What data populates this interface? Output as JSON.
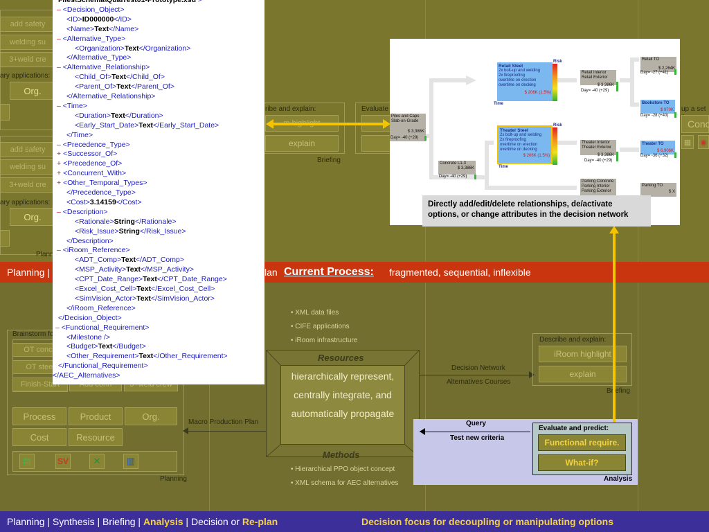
{
  "xml_lines": [
    {
      "d": 0,
      "t": [
        [
          "tx",
          "Files\\Schema\\Quarrest01-Prototype.xsd"
        ],
        [
          "tg",
          " >"
        ]
      ]
    },
    {
      "d": 0,
      "m": "–",
      "t": [
        [
          "tg",
          "<Decision_Object>"
        ]
      ]
    },
    {
      "d": 1,
      "t": [
        [
          "tg",
          "<ID>"
        ],
        [
          "tx",
          "ID000000"
        ],
        [
          "tg",
          "</ID>"
        ]
      ]
    },
    {
      "d": 1,
      "t": [
        [
          "tg",
          "<Name>"
        ],
        [
          "tx",
          "Text"
        ],
        [
          "tg",
          "</Name>"
        ]
      ]
    },
    {
      "d": 0,
      "m": "–",
      "t": [
        [
          "tg",
          "<Alternative_Type>"
        ]
      ]
    },
    {
      "d": 2,
      "t": [
        [
          "tg",
          "<Organization>"
        ],
        [
          "tx",
          "Text"
        ],
        [
          "tg",
          "</Organization>"
        ]
      ]
    },
    {
      "d": 1,
      "t": [
        [
          "tg",
          "</Alternative_Type>"
        ]
      ]
    },
    {
      "d": 0,
      "m": "–",
      "t": [
        [
          "tg",
          "<Alternative_Relationship>"
        ]
      ]
    },
    {
      "d": 2,
      "t": [
        [
          "tg",
          "<Child_Of>"
        ],
        [
          "tx",
          "Text"
        ],
        [
          "tg",
          "</Child_Of>"
        ]
      ]
    },
    {
      "d": 2,
      "t": [
        [
          "tg",
          "<Parent_Of>"
        ],
        [
          "tx",
          "Text"
        ],
        [
          "tg",
          "</Parent_Of>"
        ]
      ]
    },
    {
      "d": 1,
      "t": [
        [
          "tg",
          "</Alternative_Relationship>"
        ]
      ]
    },
    {
      "d": 0,
      "m": "–",
      "t": [
        [
          "tg",
          "<Time>"
        ]
      ]
    },
    {
      "d": 2,
      "t": [
        [
          "tg",
          "<Duration>"
        ],
        [
          "tx",
          "Text"
        ],
        [
          "tg",
          "</Duration>"
        ]
      ]
    },
    {
      "d": 2,
      "t": [
        [
          "tg",
          "<Early_Start_Date>"
        ],
        [
          "tx",
          "Text"
        ],
        [
          "tg",
          "</Early_Start_Date>"
        ]
      ]
    },
    {
      "d": 1,
      "t": [
        [
          "tg",
          "</Time>"
        ]
      ]
    },
    {
      "d": 0,
      "m": "–",
      "t": [
        [
          "tg",
          "<Precedence_Type>"
        ]
      ]
    },
    {
      "d": 0,
      "m": "+",
      "t": [
        [
          "tg",
          "<Successor_Of>"
        ]
      ]
    },
    {
      "d": 0,
      "m": "+",
      "t": [
        [
          "tg",
          "<Precedence_Of>"
        ]
      ]
    },
    {
      "d": 0,
      "m": "+",
      "t": [
        [
          "tg",
          "<Concurrent_With>"
        ]
      ]
    },
    {
      "d": 0,
      "m": "+",
      "t": [
        [
          "tg",
          "<Other_Temporal_Types>"
        ]
      ]
    },
    {
      "d": 1,
      "t": [
        [
          "tg",
          "</Precedence_Type>"
        ]
      ]
    },
    {
      "d": 1,
      "t": [
        [
          "tg",
          "<Cost>"
        ],
        [
          "tx",
          "3.14159"
        ],
        [
          "tg",
          "</Cost>"
        ]
      ]
    },
    {
      "d": 0,
      "m": "–",
      "t": [
        [
          "tg",
          "<Description>"
        ]
      ]
    },
    {
      "d": 2,
      "t": [
        [
          "tg",
          "<Rationale>"
        ],
        [
          "tx",
          "String"
        ],
        [
          "tg",
          "</Rationale>"
        ]
      ]
    },
    {
      "d": 2,
      "t": [
        [
          "tg",
          "<Risk_Issue>"
        ],
        [
          "tx",
          "String"
        ],
        [
          "tg",
          "</Risk_Issue>"
        ]
      ]
    },
    {
      "d": 1,
      "t": [
        [
          "tg",
          "</Description>"
        ]
      ]
    },
    {
      "d": 0,
      "m": "–",
      "t": [
        [
          "tg",
          "<iRoom_Reference>"
        ]
      ]
    },
    {
      "d": 2,
      "t": [
        [
          "tg",
          "<ADT_Comp>"
        ],
        [
          "tx",
          "Text"
        ],
        [
          "tg",
          "</ADT_Comp>"
        ]
      ]
    },
    {
      "d": 2,
      "t": [
        [
          "tg",
          "<MSP_Activity>"
        ],
        [
          "tx",
          "Text"
        ],
        [
          "tg",
          "</MSP_Activity>"
        ]
      ]
    },
    {
      "d": 2,
      "t": [
        [
          "tg",
          "<CPT_Date_Range>"
        ],
        [
          "tx",
          "Text"
        ],
        [
          "tg",
          "</CPT_Date_Range>"
        ]
      ]
    },
    {
      "d": 2,
      "t": [
        [
          "tg",
          "<Excel_Cost_Cell>"
        ],
        [
          "tx",
          "Text"
        ],
        [
          "tg",
          "</Excel_Cost_Cell>"
        ]
      ]
    },
    {
      "d": 2,
      "t": [
        [
          "tg",
          "<SimVision_Actor>"
        ],
        [
          "tx",
          "Text"
        ],
        [
          "tg",
          "</SimVision_Actor>"
        ]
      ]
    },
    {
      "d": 1,
      "t": [
        [
          "tg",
          "</iRoom_Reference>"
        ]
      ]
    },
    {
      "d": 0,
      "t": [
        [
          "tg",
          "</Decision_Object>"
        ]
      ]
    },
    {
      "d": -1,
      "m": "–",
      "t": [
        [
          "tg",
          "<Functional_Requirement>"
        ]
      ]
    },
    {
      "d": 1,
      "t": [
        [
          "tg",
          "<Milestone />"
        ]
      ]
    },
    {
      "d": 1,
      "t": [
        [
          "tg",
          "<Budget>"
        ],
        [
          "tx",
          "Text"
        ],
        [
          "tg",
          "</Budget>"
        ]
      ]
    },
    {
      "d": 1,
      "t": [
        [
          "tg",
          "<Other_Requirement>"
        ],
        [
          "tx",
          "Text"
        ],
        [
          "tg",
          "</Other_Requirement>"
        ]
      ]
    },
    {
      "d": 0,
      "t": [
        [
          "tg",
          "</Functional_Requirement>"
        ]
      ]
    },
    {
      "d": -2,
      "t": [
        [
          "tg",
          "</AEC_Alternatives>"
        ]
      ]
    }
  ],
  "left_panel_top": {
    "btns1": [
      "add safety",
      "welding su",
      "3+weld cre"
    ],
    "label1": "ary applications:",
    "org1": "Org.",
    "btns2": [
      "add safety",
      "welding su",
      "3+weld cre"
    ],
    "label2": "ary applications:",
    "org2": "Org.",
    "plan_label": "Plann"
  },
  "mid_top": {
    "describe_label": "ribe and explain:",
    "highlight": "m highlight",
    "explain": "explain",
    "evaluate_label": "Evaluate",
    "briefing": "Briefing",
    "right_label": "up a set o",
    "right_btn": "Conc"
  },
  "network": {
    "piles_title": "Piles and Caps",
    "piles_sub": "Slab-on-Grade",
    "piles_cost": "$ 3,386K",
    "piles_day": "Day= -40 (+29)",
    "concrete_title": "Concrete L1-3",
    "concrete_cost": "$ 3,386K",
    "concrete_day": "Day= -40 (+29)",
    "retail_title": "Retail Steel",
    "retail_lines": [
      "2x bolt-up and welding",
      "2x fireproofing",
      "overtime on erection",
      "overtime on decking"
    ],
    "retail_cost": "$ 206K (1.5%)",
    "theater_title": "Theater Steel",
    "theater_lines": [
      "2x bolt-up and welding",
      "2x fireproofing",
      "overtime on erection",
      "overtime on decking"
    ],
    "theater_cost": "$ 206K (1.5%)",
    "risk": "Risk",
    "time": "Time",
    "retail_int_title": "Retail Interior",
    "retail_int_sub": "Retail Exterior",
    "retail_int_cost": "$ 3,386K",
    "retail_int_day": "Day= -40 (+29)",
    "theater_int_title": "Theater Interior",
    "theater_int_sub": "Theater Exterior",
    "theater_int_cost": "$ 3,386K",
    "theater_int_day": "Day= -40 (+29)",
    "parking_title": "Parking Concrete",
    "parking_sub1": "Parking Interior",
    "parking_sub2": "Parking Exterior",
    "retail_to_title": "Retail TO",
    "retail_to_cost": "$ 2,264K",
    "retail_to_day": "Day= -27 (+41)",
    "bookstore_title": "Bookstore TO",
    "bookstore_cost": "$ 970K",
    "bookstore_day": "Day= -28 (+40)",
    "theater_to_title": "Theater TO",
    "theater_to_cost": "$ 6,906K",
    "theater_to_day": "Day= -36 (+32)",
    "parking_to_title": "Parking TO",
    "parking_to_cost": "$ X"
  },
  "callout": "Directly add/edit/delete relationships, de/activate options, or change attributes in the decision network",
  "red_band": {
    "left": "Planning |",
    "plan": "lan",
    "current": "Current Process:",
    "desc": "fragmented, sequential, inflexible"
  },
  "lower": {
    "brainstorm": "Brainstorm fo",
    "left_btns": [
      "OT conce",
      "OT steel",
      "Finish-Start"
    ],
    "add_conn": "Add conn",
    "crew": "3+weld crew",
    "cat_btns": [
      "Process",
      "Product",
      "Org.",
      "Cost",
      "Resource"
    ],
    "planning": "Planning",
    "macro": "Macro Production Plan",
    "bullets_top": [
      "XML data files",
      "CIFE applications",
      "iRoom infrastructure"
    ],
    "resources": "Resources",
    "res_lines": [
      "hierarchically represent,",
      "centrally integrate, and",
      "automatically propagate"
    ],
    "methods": "Methods",
    "bullets_bottom": [
      "Hierarchical PPO object concept",
      "XML schema for AEC alternatives"
    ],
    "decision_network": "Decision Network",
    "alt_courses": "Alternatives Courses",
    "describe_label": "Describe and explain:",
    "iroom_highlight": "iRoom highlight",
    "explain": "explain",
    "briefing": "Briefing",
    "query": "Query",
    "test_criteria": "Test new criteria",
    "evaluate": "Evaluate and predict:",
    "functional": "Functional require.",
    "whatif": "What-if?",
    "analysis": "Analysis"
  },
  "footer": {
    "planning": "Planning",
    "synthesis": "Synthesis",
    "briefing": "Briefing",
    "analysis": "Analysis",
    "decision": "Decision or",
    "replan": "Re-plan",
    "sep": "|",
    "right": "Decision focus for decoupling or manipulating options"
  },
  "colors": {
    "accent": "#f5c400",
    "red": "#c9350f",
    "blue": "#3d2f9a"
  }
}
